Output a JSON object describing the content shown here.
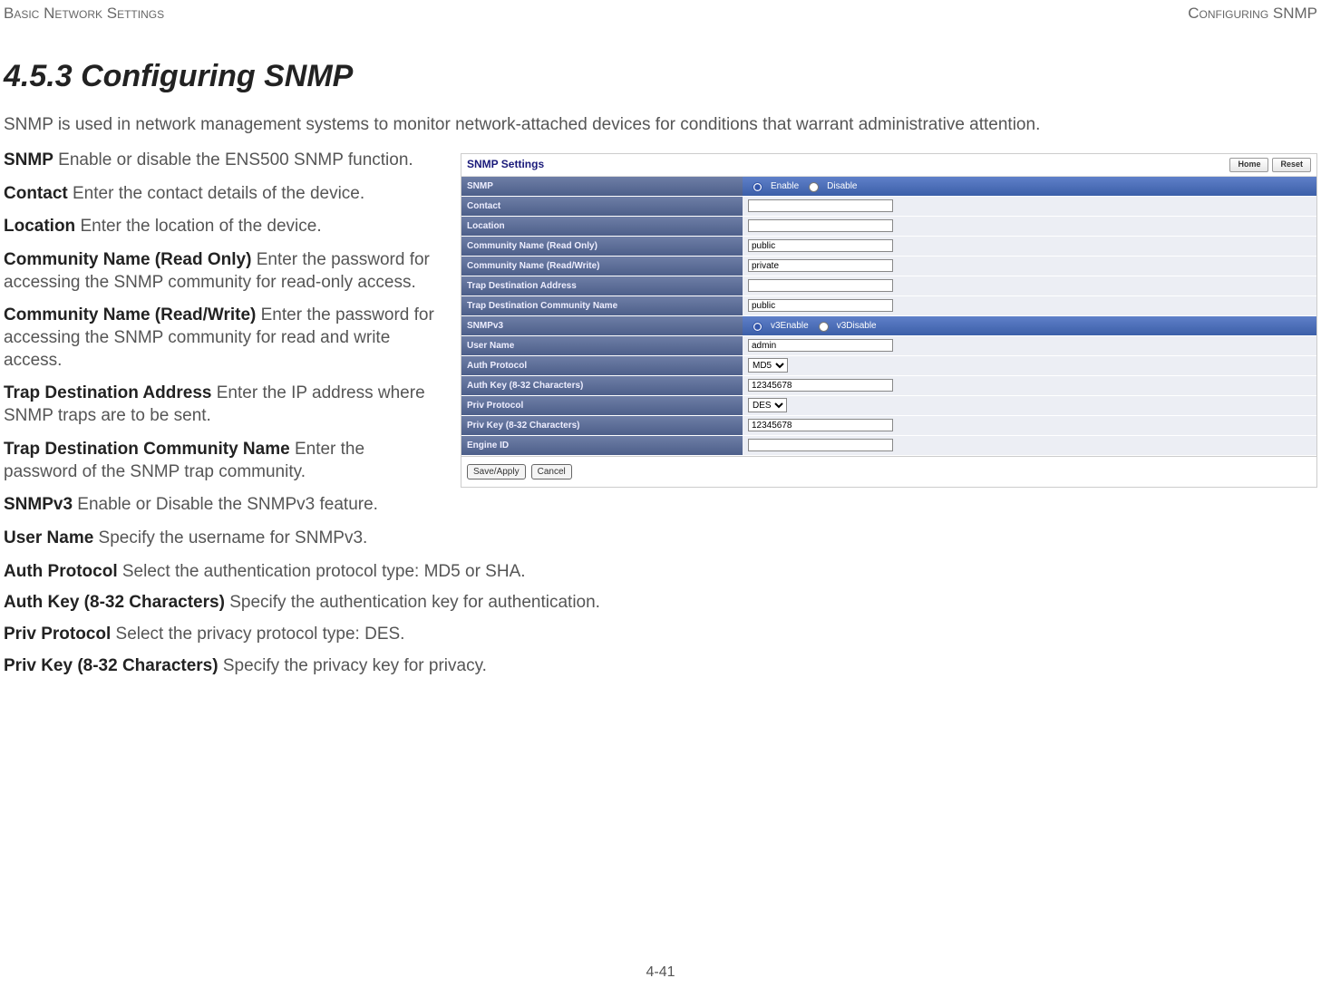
{
  "header": {
    "left": "Basic Network Settings",
    "right": "Configuring SNMP"
  },
  "heading": "4.5.3 Configuring SNMP",
  "intro": "SNMP is used in network management systems to monitor network-attached devices for conditions that warrant administrative attention.",
  "defs_left": [
    {
      "term": "SNMP",
      "desc": "  Enable or disable the ENS500 SNMP function."
    },
    {
      "term": "Contact",
      "desc": "  Enter the contact details of the device."
    },
    {
      "term": "Location",
      "desc": "  Enter the location of the device."
    },
    {
      "term": "Community Name (Read Only)",
      "desc": "  Enter the password for accessing the SNMP community for read-only access."
    },
    {
      "term": "Community Name (Read/Write)",
      "desc": "  Enter the password for accessing the SNMP community for read and write access."
    },
    {
      "term": "Trap Destination Address",
      "desc": "  Enter the IP address where SNMP traps are to be sent."
    },
    {
      "term": "Trap Destination Community Name",
      "desc": "  Enter the password of the SNMP trap community."
    },
    {
      "term": "SNMPv3",
      "desc": "  Enable or Disable the SNMPv3 feature."
    },
    {
      "term": "User Name",
      "desc": "  Specify the username for SNMPv3."
    }
  ],
  "defs_full": [
    {
      "term": "Auth Protocol",
      "desc": "  Select the authentication protocol type: MD5 or SHA."
    },
    {
      "term": "Auth Key (8-32 Characters)",
      "desc": "  Specify the authentication key for authentication."
    },
    {
      "term": "Priv Protocol",
      "desc": "  Select the privacy protocol type: DES."
    },
    {
      "term": "Priv Key (8-32 Characters)",
      "desc": "  Specify the privacy key for privacy."
    }
  ],
  "figure": {
    "title": "SNMP Settings",
    "buttons": {
      "home": "Home",
      "reset": "Reset"
    },
    "rows": {
      "snmp": {
        "label": "SNMP",
        "opt1": "Enable",
        "opt2": "Disable"
      },
      "contact": {
        "label": "Contact",
        "value": ""
      },
      "location": {
        "label": "Location",
        "value": ""
      },
      "comm_ro": {
        "label": "Community Name (Read Only)",
        "value": "public"
      },
      "comm_rw": {
        "label": "Community Name (Read/Write)",
        "value": "private"
      },
      "trap_addr": {
        "label": "Trap Destination Address",
        "value": ""
      },
      "trap_comm": {
        "label": "Trap Destination Community Name",
        "value": "public"
      },
      "snmpv3": {
        "label": "SNMPv3",
        "opt1": "v3Enable",
        "opt2": "v3Disable"
      },
      "user": {
        "label": "User Name",
        "value": "admin"
      },
      "auth_proto": {
        "label": "Auth Protocol",
        "value": "MD5"
      },
      "auth_key": {
        "label": "Auth Key (8-32 Characters)",
        "value": "12345678"
      },
      "priv_proto": {
        "label": "Priv Protocol",
        "value": "DES"
      },
      "priv_key": {
        "label": "Priv Key (8-32 Characters)",
        "value": "12345678"
      },
      "engine": {
        "label": "Engine ID",
        "value": ""
      }
    },
    "footer": {
      "save": "Save/Apply",
      "cancel": "Cancel"
    }
  },
  "page_number": "4-41"
}
